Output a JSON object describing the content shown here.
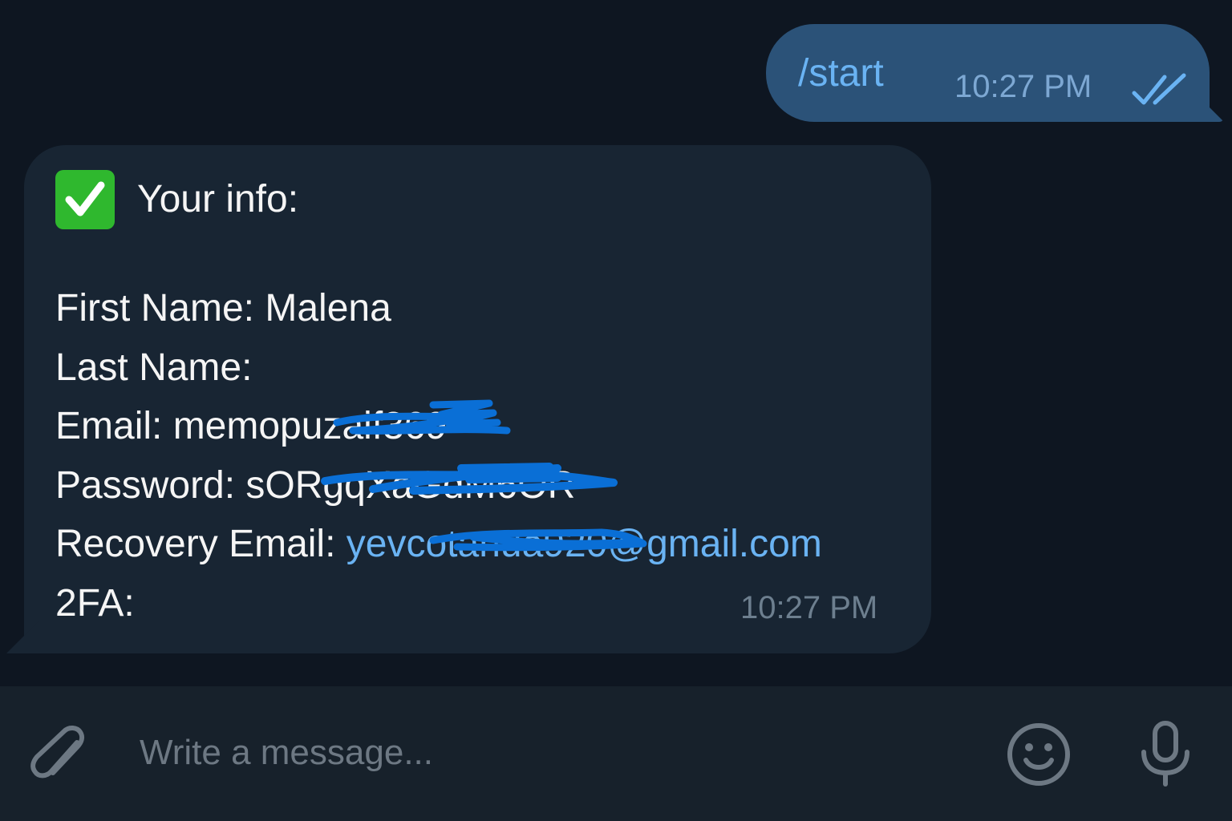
{
  "outgoing": {
    "text": "/start",
    "time": "10:27 PM",
    "status_icon": "double-check-icon"
  },
  "incoming": {
    "header": "Your info:",
    "header_icon": "white-check-mark-emoji",
    "first_name": "First Name: Malena",
    "last_name": "Last Name:",
    "email_prefix": "Email: memopuz",
    "email_redacted": "aif369",
    "password_prefix": "Password: sORgq",
    "password_redacted": "XaGdM6OR",
    "recovery_label": "Recovery Email: ",
    "recovery_link_start": "yevc",
    "recovery_link_redacted": "otanua920",
    "recovery_link_end": "@gmail.com",
    "twofa": "2FA:",
    "time": "10:27 PM"
  },
  "composer": {
    "placeholder": "Write a message...",
    "attach_icon": "paperclip-icon",
    "emoji_icon": "smiley-icon",
    "mic_icon": "microphone-icon"
  },
  "colors": {
    "background": "#0e1621",
    "outgoing_bubble": "#2b5278",
    "incoming_bubble": "#182533",
    "composer": "#17212b",
    "link": "#6ab3f3",
    "redaction_scribble": "#0a6fd6",
    "check_emoji": "#2fb82e"
  }
}
